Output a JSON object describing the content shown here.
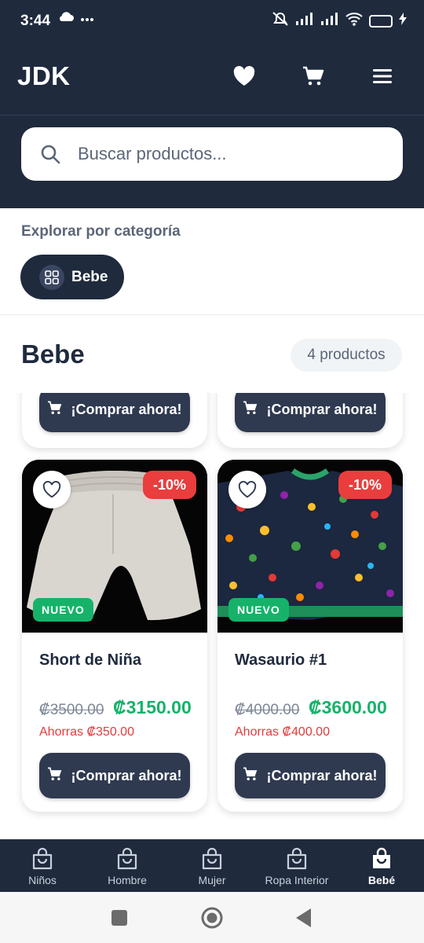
{
  "status_bar": {
    "time": "3:44",
    "battery": "68"
  },
  "header": {
    "logo": "JDK",
    "icons": [
      "heart-icon",
      "cart-icon",
      "menu-icon"
    ]
  },
  "search": {
    "placeholder": "Buscar productos..."
  },
  "categories": {
    "label": "Explorar por categoría",
    "chips": [
      {
        "label": "Bebe",
        "icon": "grid-icon"
      }
    ]
  },
  "section": {
    "title": "Bebe",
    "count": "4 productos"
  },
  "buy_label": "¡Comprar ahora!",
  "products": [
    {
      "name": "Short de Niña",
      "discount": "-10%",
      "badge": "NUEVO",
      "old_price": "₡3500.00",
      "price": "₡3150.00",
      "savings": "Ahorras ₡350.00"
    },
    {
      "name": "Wasaurio #1",
      "discount": "-10%",
      "badge": "NUEVO",
      "old_price": "₡4000.00",
      "price": "₡3600.00",
      "savings": "Ahorras ₡400.00"
    }
  ],
  "bottom_nav": {
    "items": [
      {
        "label": "Niños",
        "icon": "bag-icon",
        "active": false
      },
      {
        "label": "Hombre",
        "icon": "bag-icon",
        "active": false
      },
      {
        "label": "Mujer",
        "icon": "bag-icon",
        "active": false
      },
      {
        "label": "Ropa Interior",
        "icon": "bag-icon",
        "active": false
      },
      {
        "label": "Bebé",
        "icon": "bag-icon",
        "active": true
      }
    ]
  },
  "colors": {
    "primary": "#1f2a3d",
    "accent_green": "#17b26a",
    "discount_red": "#ea3d3d"
  }
}
